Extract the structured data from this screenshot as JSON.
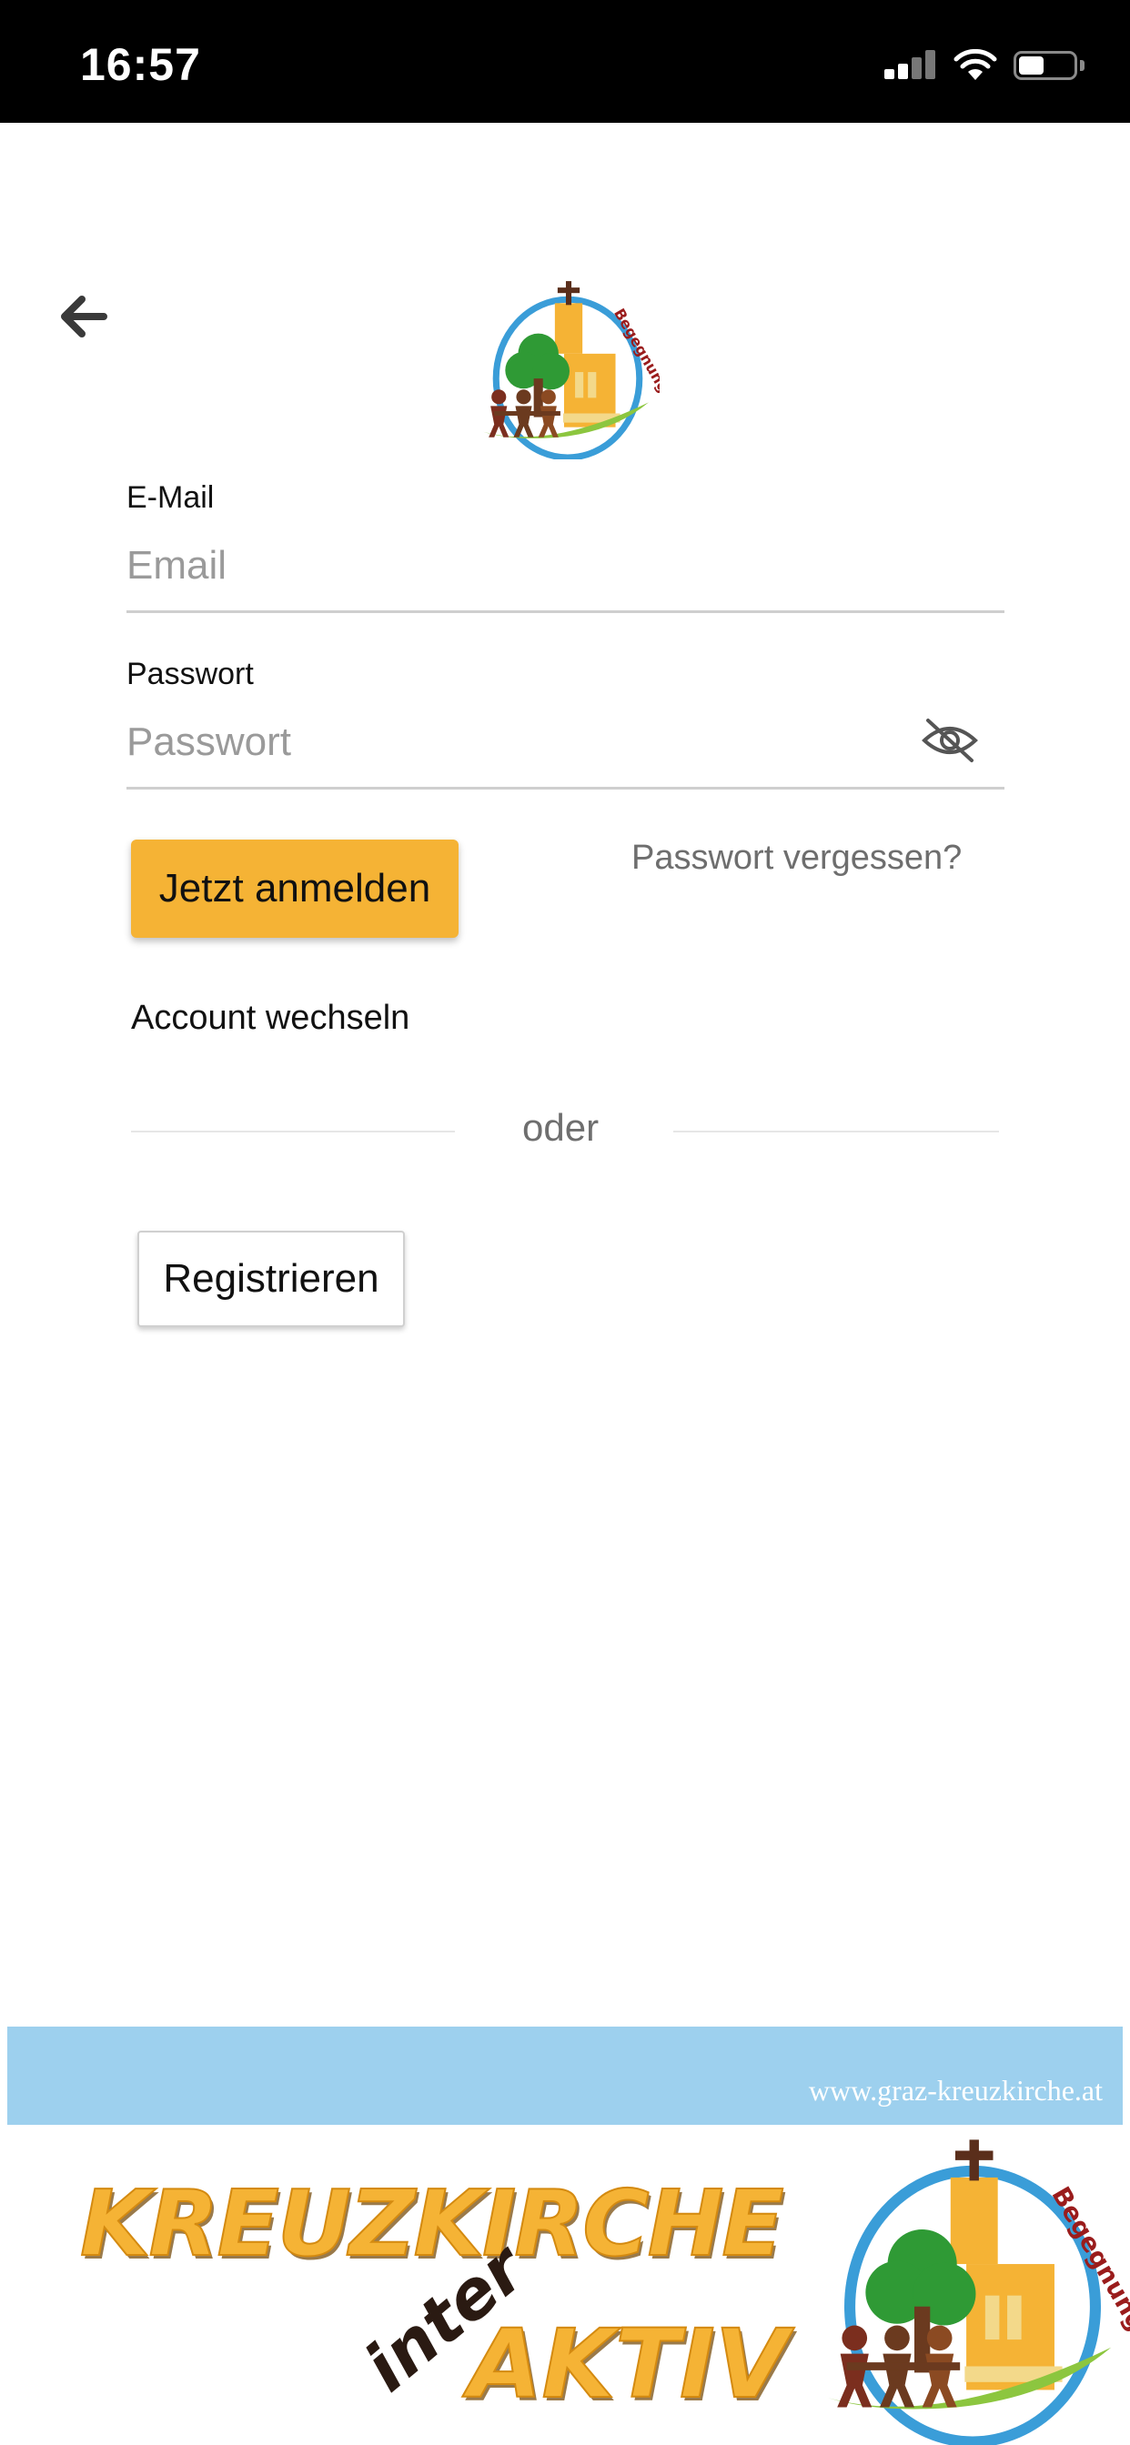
{
  "status_bar": {
    "time": "16:57"
  },
  "header": {
    "back_icon": "arrow-left-icon",
    "logo_icon": "kreuzkirche-logo-icon"
  },
  "form": {
    "email_label": "E-Mail",
    "email_placeholder": "Email",
    "email_value": "",
    "password_label": "Passwort",
    "password_placeholder": "Passwort",
    "password_value": "",
    "visibility_icon": "eye-slash-icon",
    "login_button": "Jetzt anmelden",
    "forgot_password": "Passwort vergessen?",
    "switch_account": "Account wechseln",
    "divider_text": "oder",
    "register_button": "Registrieren"
  },
  "footer_banner": {
    "url": "www.graz-kreuzkirche.at",
    "title_line": "KREUZKIRCHE",
    "inter": "inter",
    "aktiv": "AKTIV",
    "logo_icon": "kreuzkirche-logo-icon"
  },
  "colors": {
    "accent": "#f5b335",
    "banner_blue": "#9dd0ee",
    "status_bar": "#000000"
  }
}
